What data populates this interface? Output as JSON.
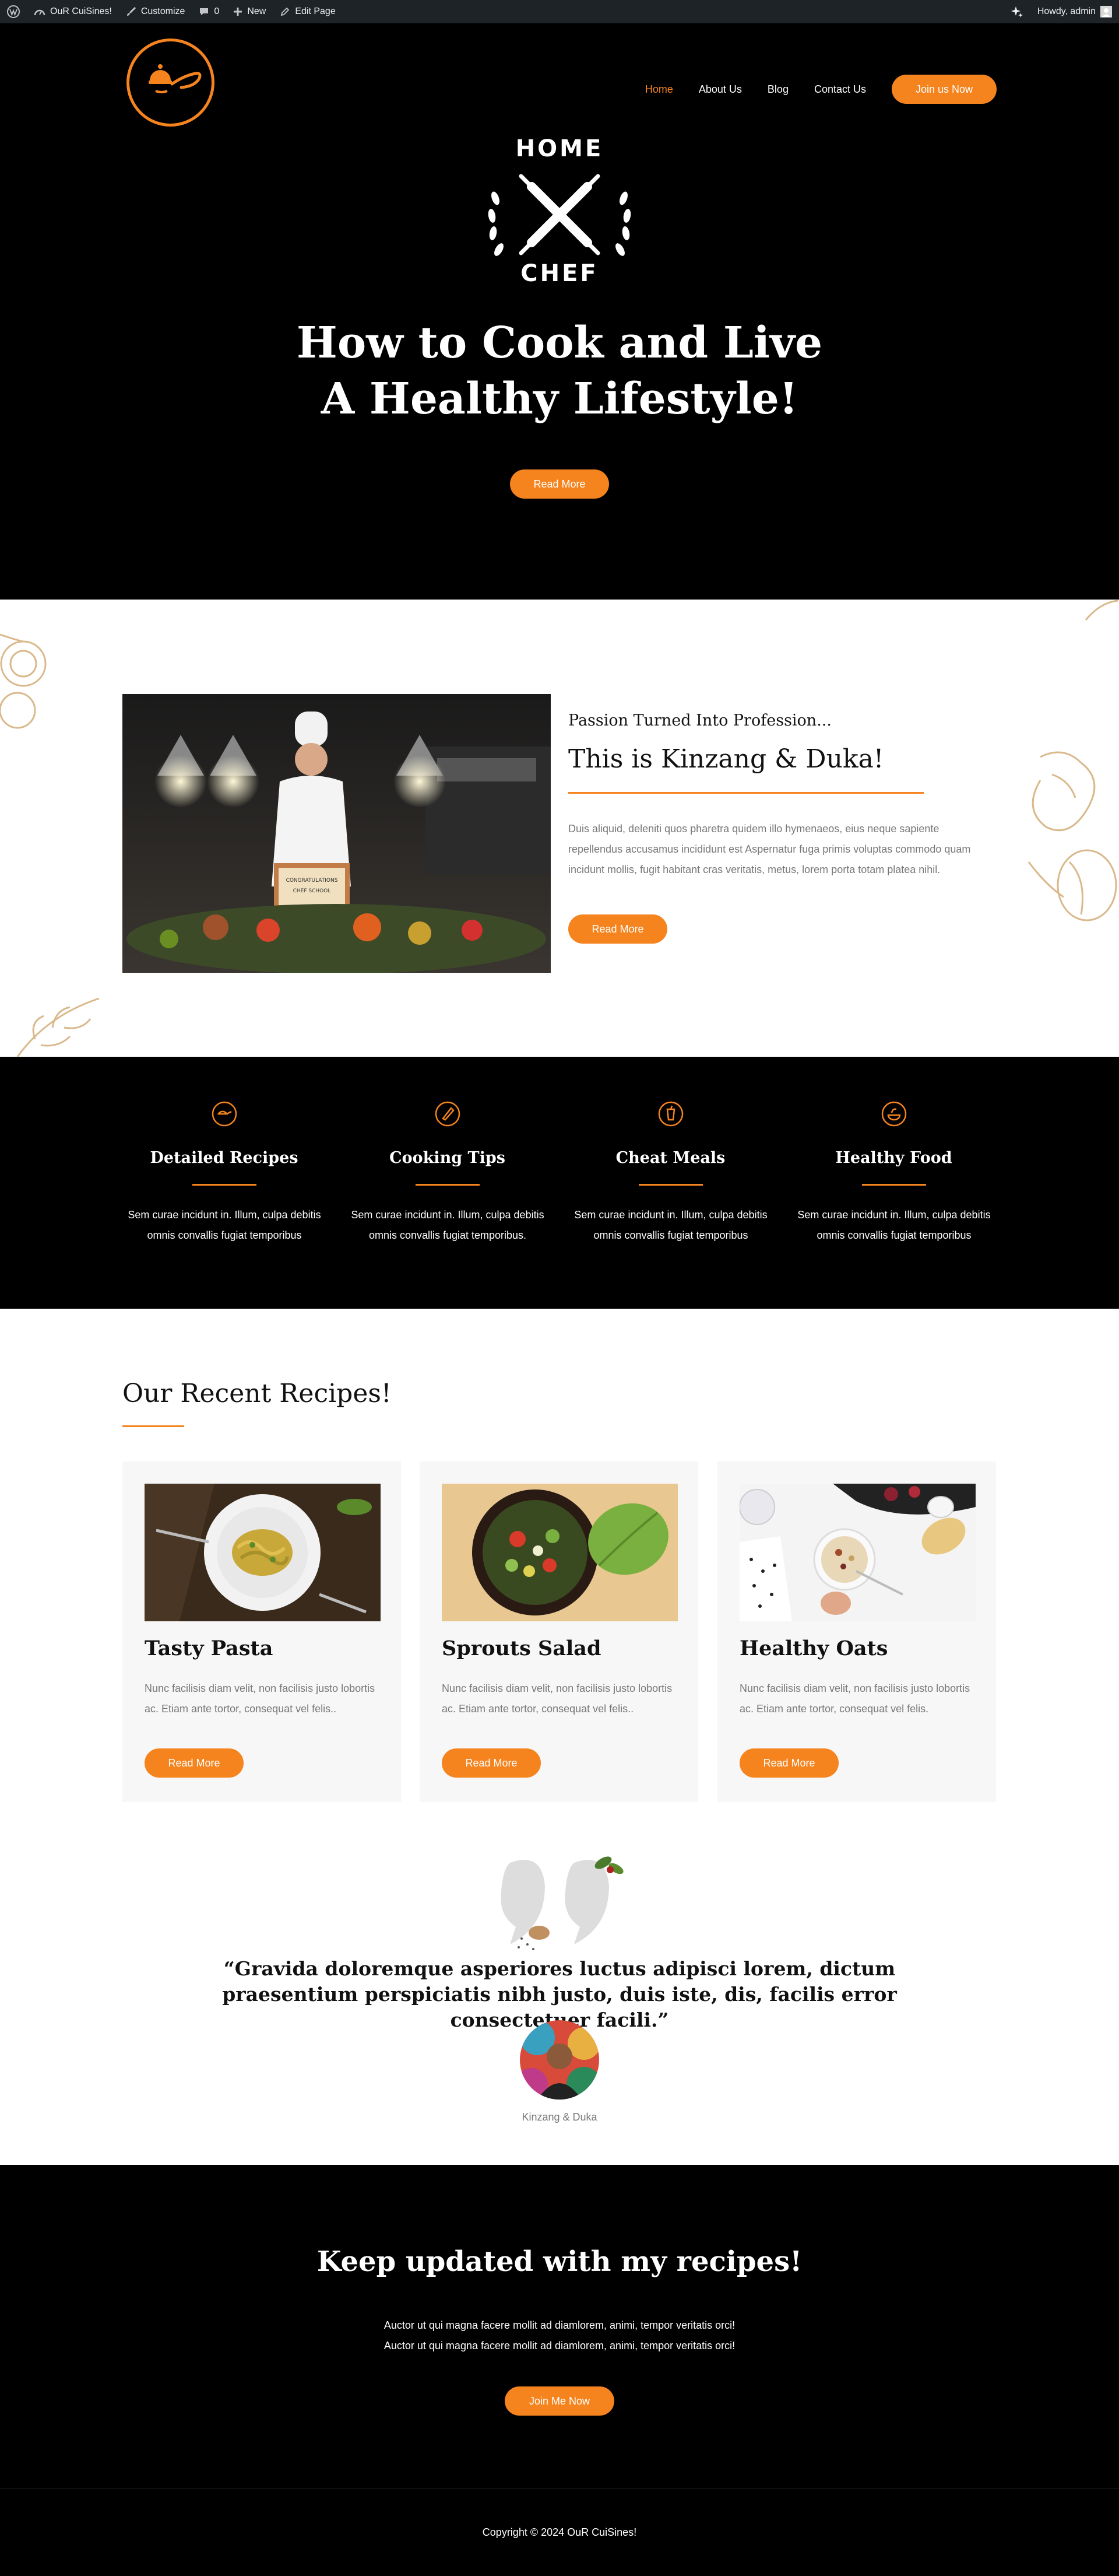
{
  "admin_bar": {
    "site_name": "OuR CuiSines!",
    "customize": "Customize",
    "comments_count": "0",
    "new": "New",
    "edit_page": "Edit Page",
    "howdy": "Howdy, admin"
  },
  "header": {
    "nav": [
      "Home",
      "About Us",
      "Blog",
      "Contact Us"
    ],
    "join_label": "Join us Now"
  },
  "emblem": {
    "top": "HOME",
    "bottom": "CHEF"
  },
  "hero": {
    "title_line1": "How to Cook and Live",
    "title_line2": "A Healthy Lifestyle!",
    "button": "Read More"
  },
  "about": {
    "kicker": "Passion Turned Into Profession...",
    "title": "This is Kinzang & Duka!",
    "text": "Duis aliquid, deleniti quos pharetra quidem illo hymenaeos, eius neque sapiente repellendus accusamus incididunt est Aspernatur fuga primis voluptas commodo quam incidunt mollis, fugit habitant cras veritatis, metus, lorem porta totam platea nihil.",
    "button": "Read More",
    "sign_lines": [
      "CONGRATULATIONS",
      "CHEF SCHOOL"
    ]
  },
  "features": [
    {
      "title": "Detailed Recipes",
      "text": "Sem curae incidunt in. Illum, culpa debitis omnis convallis fugiat temporibus",
      "icon": "spoon-bowl-icon"
    },
    {
      "title": "Cooking Tips",
      "text": "Sem curae incidunt in. Illum, culpa debitis omnis convallis fugiat temporibus.",
      "icon": "knife-icon"
    },
    {
      "title": "Cheat Meals",
      "text": "Sem curae incidunt in. Illum, culpa debitis omnis convallis fugiat temporibus",
      "icon": "drink-cup-icon"
    },
    {
      "title": "Healthy Food",
      "text": "Sem curae incidunt in. Illum, culpa debitis omnis convallis fugiat temporibus",
      "icon": "salad-icon"
    }
  ],
  "recipes": {
    "title": "Our Recent Recipes!",
    "items": [
      {
        "title": "Tasty Pasta",
        "text": "Nunc facilisis diam velit, non facilisis justo lobortis ac. Etiam ante tortor, consequat vel felis..",
        "button": "Read More"
      },
      {
        "title": "Sprouts Salad",
        "text": "Nunc facilisis diam velit, non facilisis justo lobortis ac. Etiam ante tortor, consequat vel felis..",
        "button": "Read More"
      },
      {
        "title": "Healthy Oats",
        "text": "Nunc facilisis diam velit, non facilisis justo lobortis ac. Etiam ante tortor, consequat vel felis.",
        "button": "Read More"
      }
    ]
  },
  "testimonial": {
    "quote": "“Gravida doloremque asperiores luctus adipisci lorem, dictum praesentium perspiciatis nibh justo, duis iste, dis, facilis error consectetuer facili.”",
    "name": "Kinzang & Duka"
  },
  "newsletter": {
    "title": "Keep updated with my recipes!",
    "text_line1": "Auctor ut qui magna facere mollit ad diamlorem, animi, tempor veritatis orci!",
    "text_line2": "Auctor ut qui magna facere mollit ad diamlorem, animi, tempor veritatis orci!",
    "button": "Join Me Now"
  },
  "footer": {
    "copyright": "Copyright © 2024 OuR CuiSines!"
  },
  "colors": {
    "accent": "#f5841f",
    "dark": "#000000",
    "admin_bar": "#1d2327",
    "card_bg": "#f7f7f7",
    "muted_text": "#777777"
  }
}
